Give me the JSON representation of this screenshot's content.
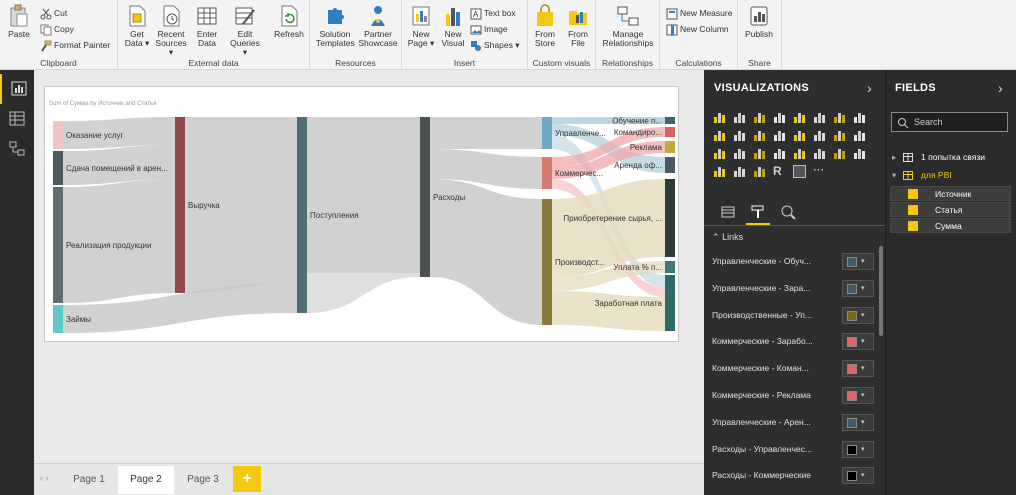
{
  "ribbon": {
    "clipboard": {
      "paste": "Paste",
      "cut": "Cut",
      "copy": "Copy",
      "format_painter": "Format Painter",
      "group": "Clipboard"
    },
    "external_data": {
      "get_data": "Get Data ▾",
      "recent_sources": "Recent Sources ▾",
      "enter_data": "Enter Data",
      "edit_queries": "Edit Queries ▾",
      "refresh": "Refresh",
      "group": "External data"
    },
    "resources": {
      "solution_templates": "Solution Templates",
      "partner_showcase": "Partner Showcase",
      "group": "Resources"
    },
    "insert": {
      "new_page": "New Page ▾",
      "new_visual": "New Visual",
      "text_box": "Text box",
      "image": "Image",
      "shapes": "Shapes ▾",
      "group": "Insert"
    },
    "custom_visuals": {
      "from_store": "From Store",
      "from_file": "From File",
      "group": "Custom visuals"
    },
    "relationships": {
      "manage": "Manage Relationships",
      "group": "Relationships"
    },
    "calculations": {
      "new_measure": "New Measure",
      "new_column": "New Column",
      "group": "Calculations"
    },
    "share": {
      "publish": "Publish",
      "group": "Share"
    }
  },
  "visual": {
    "title": "Sum of Сумма by Источник and Статья",
    "nodes": {
      "services": "Оказание услуг",
      "rent_in": "Сдача помещений в арен...",
      "products": "Реализация продукции",
      "loans": "Займы",
      "revenue": "Выручка",
      "receipts": "Поступления",
      "expenses": "Расходы",
      "mgmt": "Управленче...",
      "commercial": "Коммерчес...",
      "production": "Производст...",
      "training": "Обучение п...",
      "travel": "Командиро...",
      "ads": "Реклама",
      "office_rent": "Аренда оф...",
      "raw": "Приобретерение сырья, ...",
      "interest": "Уплата % п...",
      "salary": "Заработная плата"
    }
  },
  "pages": {
    "tabs": [
      "Page 1",
      "Page 2",
      "Page 3"
    ],
    "active": "Page 2",
    "add": "+"
  },
  "viz_pane": {
    "title": "VISUALIZATIONS",
    "links_header": "Links",
    "links": [
      {
        "label": "Управленческие - Обуч...",
        "color": "#3f5b6b"
      },
      {
        "label": "Управленческие - Зара...",
        "color": "#3f5b6b"
      },
      {
        "label": "Производственные - Уп...",
        "color": "#7a6a1a"
      },
      {
        "label": "Коммерческие - Зарабо...",
        "color": "#e06565"
      },
      {
        "label": "Коммерческие - Коман...",
        "color": "#e06565"
      },
      {
        "label": "Коммерческие - Реклама",
        "color": "#e06565"
      },
      {
        "label": "Управленческие - Арен...",
        "color": "#3f5b6b"
      },
      {
        "label": "Расходы - Управленчес...",
        "color": "#000000"
      },
      {
        "label": "Расходы - Коммерческие",
        "color": "#000000"
      }
    ]
  },
  "fields_pane": {
    "title": "FIELDS",
    "search_placeholder": "Search",
    "tables": [
      "1 попытка связи",
      "для PBI"
    ],
    "fields": [
      "Источник",
      "Статья",
      "Сумма"
    ]
  },
  "colors": {
    "accent": "#f2c811",
    "pane_dark": "#2e2e2e"
  }
}
